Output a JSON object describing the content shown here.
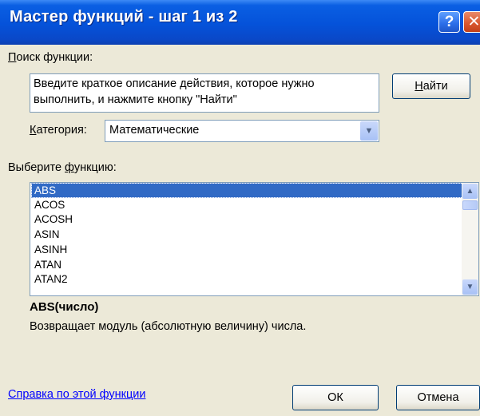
{
  "window": {
    "title": "Мастер функций - шаг 1 из 2",
    "help_glyph": "?",
    "close_glyph": "✕"
  },
  "search": {
    "label_u": "П",
    "label_rest": "оиск функции:",
    "text": "Введите краткое описание действия, которое нужно выполнить, и нажмите кнопку \"Найти\"",
    "button_u": "Н",
    "button_rest": "айти"
  },
  "category": {
    "label_u": "К",
    "label_rest": "атегория:",
    "value": "Математические"
  },
  "functions": {
    "label_pre": "Выберите ",
    "label_u": "ф",
    "label_rest": "ункцию:",
    "items": [
      "ABS",
      "ACOS",
      "ACOSH",
      "ASIN",
      "ASINH",
      "ATAN",
      "ATAN2"
    ],
    "selected": "ABS"
  },
  "details": {
    "signature": "ABS(число)",
    "description": "Возвращает модуль (абсолютную величину) числа."
  },
  "footer": {
    "help_link": "Справка по этой функции",
    "ok_label": "ОК",
    "cancel_label": "Отмена"
  },
  "icons": {
    "dropdown": "chevron-down-icon",
    "scroll_up": "chevron-up-icon",
    "scroll_down": "chevron-down-icon"
  },
  "colors": {
    "title_bar": "#0552d9",
    "dialog_bg": "#ece9d8",
    "selection": "#316ac5",
    "link": "#0000ff"
  }
}
